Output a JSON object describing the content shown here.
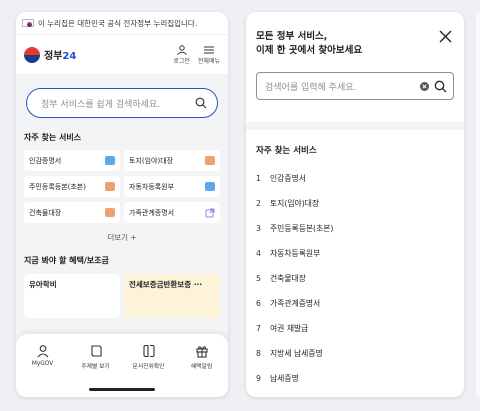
{
  "left": {
    "banner": "이 누리집은 대한민국 공식 전자정부 누리집입니다.",
    "logo": {
      "prefix": "정부",
      "num": "24"
    },
    "header_actions": [
      {
        "label": "로그인",
        "icon": "person-icon"
      },
      {
        "label": "전체메뉴",
        "icon": "hamburger-icon"
      }
    ],
    "search_placeholder": "정부 서비스를 쉽게 검색하세요.",
    "frequent_title": "자주 찾는 서비스",
    "services": [
      {
        "label": "인감증명서",
        "icon_color": "#5aa9ee"
      },
      {
        "label": "토지(임야)대장",
        "icon_color": "#f0a070"
      },
      {
        "label": "주민등록등본(초본)",
        "icon_color": "#f0a070"
      },
      {
        "label": "자동차등록원부",
        "icon_color": "#5aa9ee"
      },
      {
        "label": "건축물대장",
        "icon_color": "#f0a070"
      },
      {
        "label": "가족관계증명서",
        "icon_color": "#9a86e8"
      }
    ],
    "more_label": "더보기 +",
    "benefits_title": "지금 봐야 할 혜택/보조금",
    "benefits": [
      {
        "label": "유아학비"
      },
      {
        "label": "전세보증금반환보증 ···"
      }
    ],
    "bottom_nav": [
      {
        "label": "MyGOV",
        "icon": "user-icon"
      },
      {
        "label": "주제별 보기",
        "icon": "book-icon"
      },
      {
        "label": "문서진위확인",
        "icon": "document-icon"
      },
      {
        "label": "혜택알림",
        "icon": "gift-icon"
      }
    ]
  },
  "right": {
    "title_line1": "모든 정부 서비스,",
    "title_line2": "이제 한 곳에서 찾아보세요",
    "search_placeholder": "검색어를 입력해 주세요.",
    "frequent_title": "자주 찾는 서비스",
    "list": [
      {
        "num": "1",
        "label": "인감증명서"
      },
      {
        "num": "2",
        "label": "토지(임야)대장"
      },
      {
        "num": "3",
        "label": "주민등록등본(초본)"
      },
      {
        "num": "4",
        "label": "자동차등록원부"
      },
      {
        "num": "5",
        "label": "건축물대장"
      },
      {
        "num": "6",
        "label": "가족관계증명서"
      },
      {
        "num": "7",
        "label": "여권 재발급"
      },
      {
        "num": "8",
        "label": "지방세 납세증명"
      },
      {
        "num": "9",
        "label": "납세증명"
      }
    ]
  }
}
